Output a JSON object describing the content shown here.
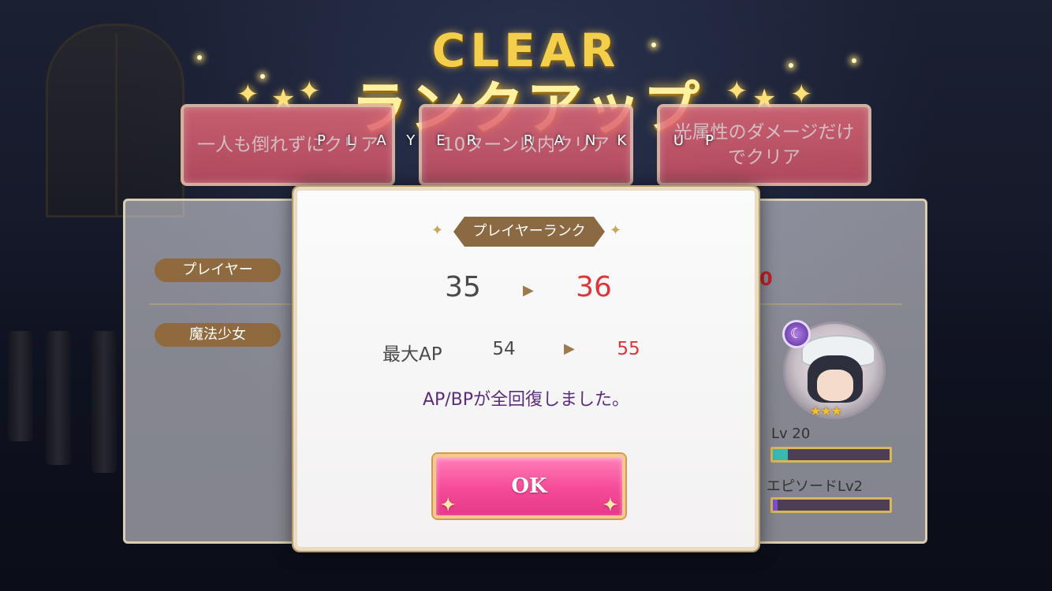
{
  "title": {
    "clear": "CLEAR",
    "rankup": "ランクアップ",
    "sub": "PLAYER RANK UP"
  },
  "missions": [
    "一人も倒れずにクリア",
    "10ターン以内クリア",
    "光属性のダメージだけでクリア"
  ],
  "back_panel": {
    "player_label": "プレイヤー",
    "magical_girl_label": "魔法少女",
    "partial_value": "0",
    "level_label": "Lv 20",
    "episode_label": "エピソードLv2",
    "level_gauge_fraction": 0.13,
    "episode_gauge_fraction": 0.04,
    "attribute_icon": "moon-icon"
  },
  "modal": {
    "header": "プレイヤーランク",
    "rank_old": "35",
    "rank_new": "36",
    "ap_label": "最大AP",
    "ap_old": "54",
    "ap_new": "55",
    "message": "AP/BPが全回復しました。",
    "ok_label": "OK"
  },
  "colors": {
    "accent_gold": "#f3cf4b",
    "new_value_red": "#e0343b",
    "message_purple": "#5a2c7f",
    "ok_pink": "#f54a98"
  }
}
